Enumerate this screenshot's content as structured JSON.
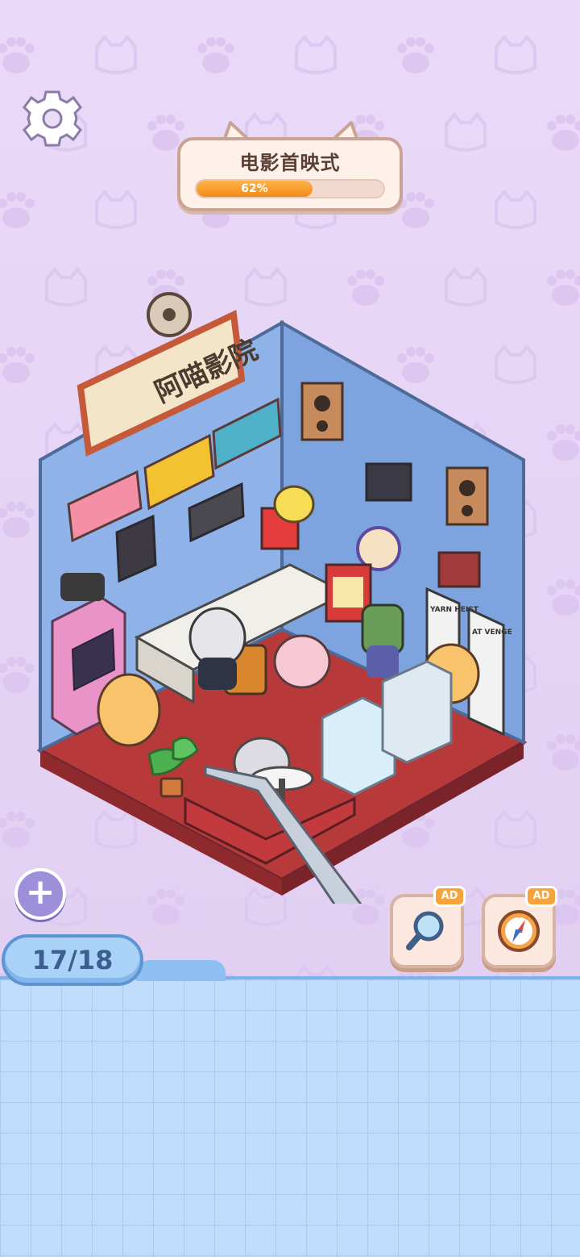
{
  "level": {
    "title": "电影首映式",
    "progress_percent": 62,
    "progress_label": "62%"
  },
  "scene": {
    "sign_text": "阿喵影院",
    "poster_1": "YARN HEIST",
    "poster_2": "AT VENGE"
  },
  "counter": {
    "text": "17/18",
    "found": 17,
    "total": 18
  },
  "hints": [
    {
      "name": "magnifier",
      "badge": "AD",
      "icon": "magnifier-icon"
    },
    {
      "name": "compass",
      "badge": "AD",
      "icon": "compass-icon"
    }
  ],
  "colors": {
    "progress_fill": "#f38b1b",
    "background_top": "#e2d0f3",
    "background_bottom": "#bfdcfb",
    "room_wall": "#8fb3e8",
    "room_floor": "#b83a36"
  }
}
